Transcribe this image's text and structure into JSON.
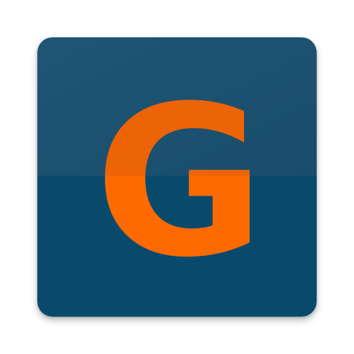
{
  "app_icon": {
    "letter": "G",
    "colors": {
      "background_top": "#1a4d6b",
      "background_top_light": "#1e5575",
      "background_bottom": "#094a6c",
      "letter_top": "#ec6405",
      "letter_bottom": "#ff6a00"
    }
  }
}
